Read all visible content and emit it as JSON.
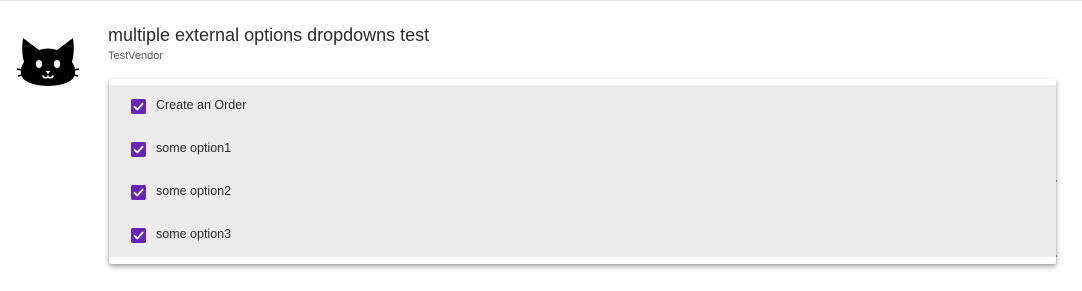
{
  "header": {
    "title": "multiple external options dropdowns test",
    "vendor": "TestVendor",
    "avatar_icon": "cat-face-icon"
  },
  "dropdown": {
    "check_icon": "checkmark-icon",
    "accent_color": "#6a23b8",
    "options": [
      {
        "label": "Create an Order",
        "checked": true
      },
      {
        "label": "some option1",
        "checked": true
      },
      {
        "label": "some option2",
        "checked": true
      },
      {
        "label": "some option3",
        "checked": true
      }
    ]
  }
}
